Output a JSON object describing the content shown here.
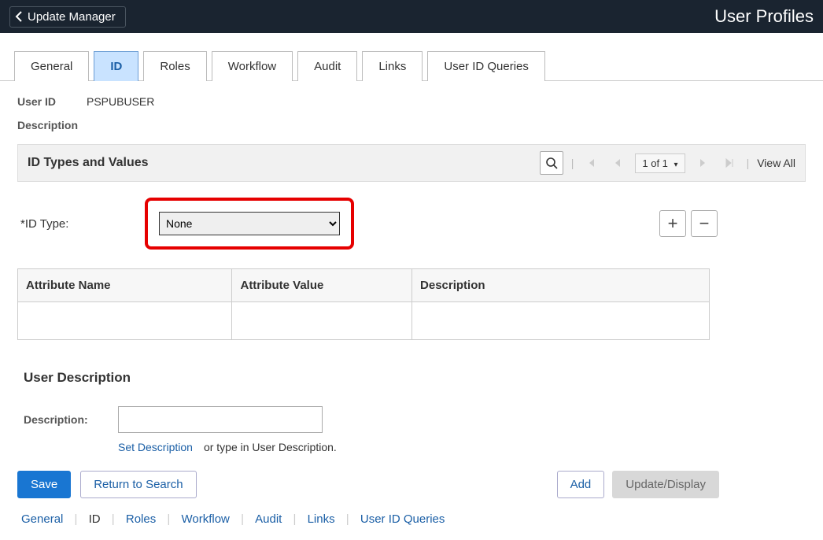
{
  "header": {
    "back_label": "Update Manager",
    "page_title": "User Profiles"
  },
  "tabs": {
    "general": "General",
    "id": "ID",
    "roles": "Roles",
    "workflow": "Workflow",
    "audit": "Audit",
    "links": "Links",
    "user_id_queries": "User ID Queries"
  },
  "user": {
    "user_id_label": "User ID",
    "user_id_value": "PSPUBUSER",
    "description_label": "Description"
  },
  "section": {
    "title": "ID Types and Values",
    "page_count": "1 of 1",
    "view_all": "View All"
  },
  "id_type": {
    "label": "*ID Type:",
    "selected": "None",
    "plus": "+",
    "minus": "−"
  },
  "table": {
    "col_attribute_name": "Attribute Name",
    "col_attribute_value": "Attribute Value",
    "col_description": "Description"
  },
  "user_desc": {
    "title": "User Description",
    "label": "Description:",
    "set_link": "Set Description",
    "hint": "or type in User Description."
  },
  "actions": {
    "save": "Save",
    "return": "Return to Search",
    "add": "Add",
    "update": "Update/Display"
  },
  "footer": {
    "general": "General",
    "id": "ID",
    "roles": "Roles",
    "workflow": "Workflow",
    "audit": "Audit",
    "links": "Links",
    "user_id_queries": "User ID Queries"
  }
}
